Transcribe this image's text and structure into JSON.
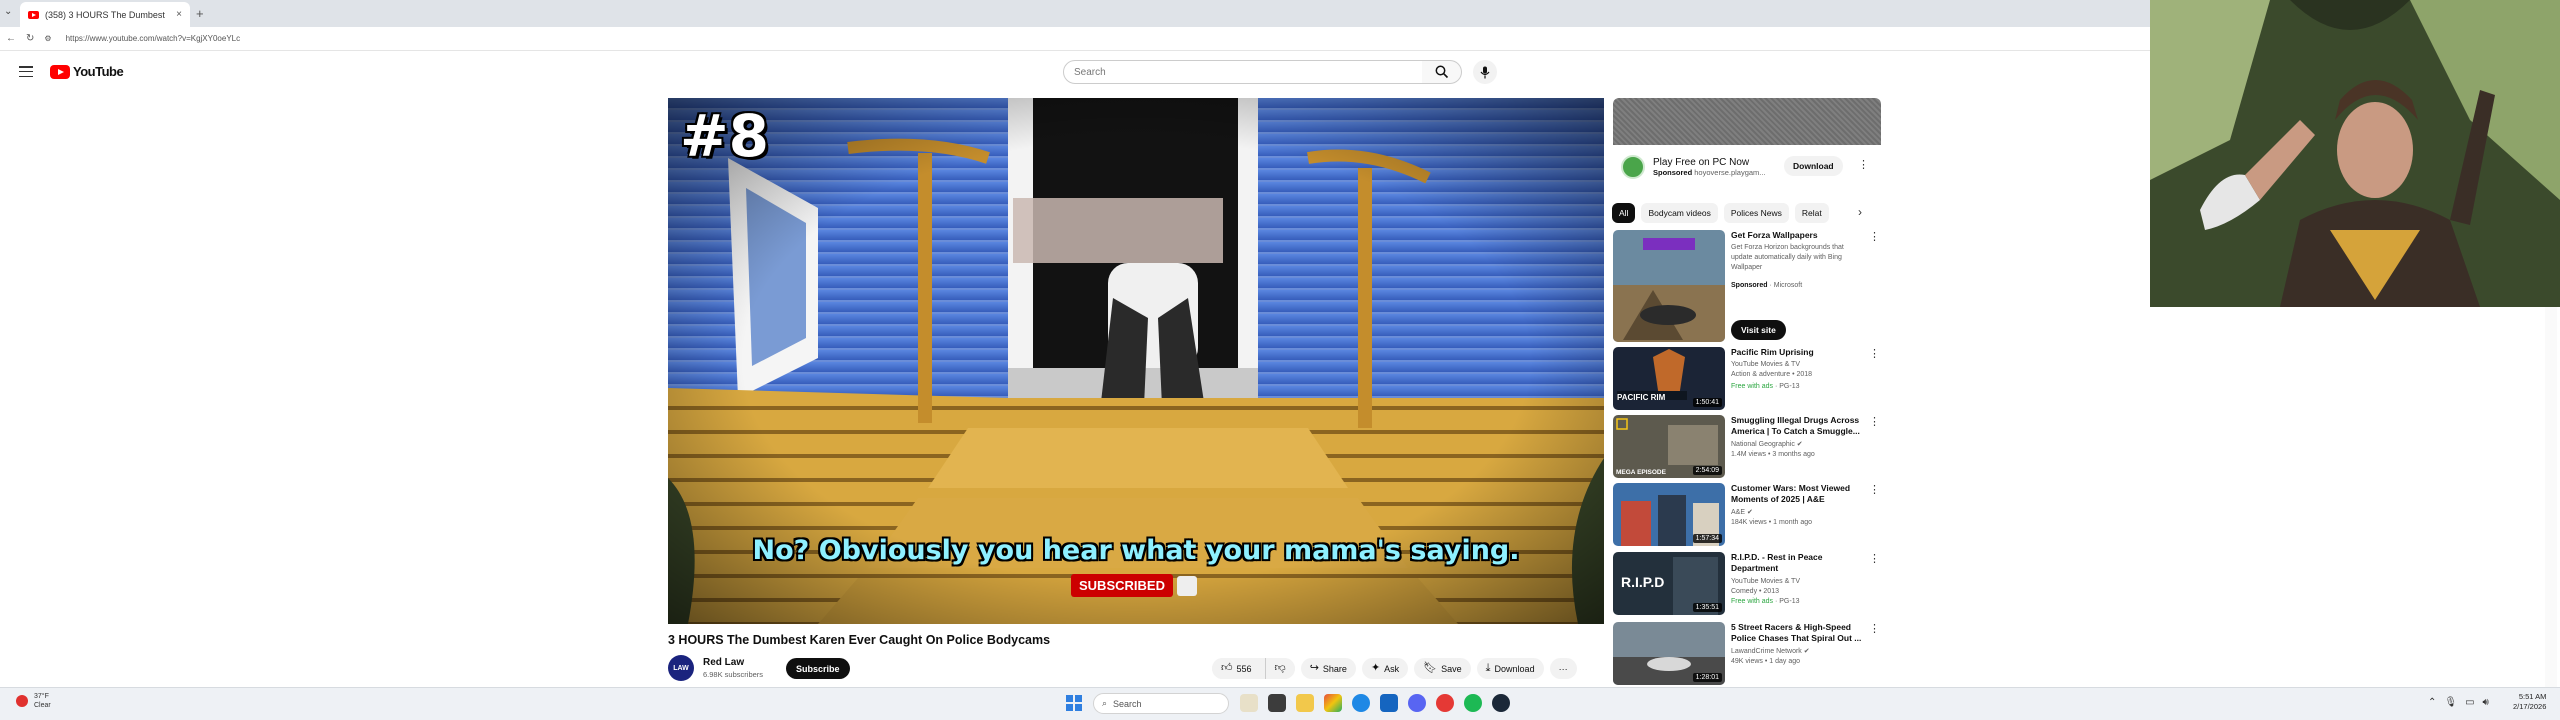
{
  "browser": {
    "tab_title": "(358) 3 HOURS The Dumbest",
    "tab_close": "×",
    "new_tab": "+",
    "url": "https://www.youtube.com/watch?v=KgjXY0oeYLc"
  },
  "yt": {
    "logo_text": "YouTube",
    "search_placeholder": "Search"
  },
  "video": {
    "rank_badge": "#8",
    "caption": "No? Obviously you hear what your mama's saying.",
    "subscribed_overlay": "SUBSCRIBED",
    "title": "3 HOURS The Dumbest Karen Ever Caught On Police Bodycams",
    "channel_name": "Red Law",
    "channel_subs": "6.98K subscribers",
    "channel_avatar_text": "LAW",
    "subscribe_label": "Subscribe",
    "like_count": "556",
    "share_label": "Share",
    "ask_label": "Ask",
    "save_label": "Save",
    "download_label": "Download",
    "more_label": "···"
  },
  "sidebar": {
    "ad": {
      "title": "Play Free on PC Now",
      "sponsored": "Sponsored",
      "advertiser": "hoyoverse.playgam...",
      "download_label": "Download"
    },
    "chips": [
      "All",
      "Bodycam videos",
      "Polices News",
      "Relat"
    ],
    "recommendations": [
      {
        "title": "Get Forza Wallpapers",
        "meta": [
          "Get Forza Horizon backgrounds that",
          "update automatically daily with Bing",
          "Wallpaper"
        ],
        "badge_prefix": "Sponsored",
        "badge_suffix": "· Microsoft",
        "visit_label": "Visit site",
        "thumb_text": ""
      },
      {
        "title": "Pacific Rim Uprising",
        "meta": [
          "YouTube Movies & TV",
          "Action & adventure • 2018"
        ],
        "free": "Free with ads",
        "rating": "· PG-13",
        "duration": "1:50:41",
        "thumb_text": "PACIFIC RIM"
      },
      {
        "title": "Smuggling Illegal Drugs Across America | To Catch a Smuggle...",
        "meta": [
          "National Geographic ✔",
          "1.4M views • 3 months ago"
        ],
        "duration": "2:54:09",
        "thumb_text": "MEGA EPISODE"
      },
      {
        "title": "Customer Wars: Most Viewed Moments of 2025 | A&E",
        "meta": [
          "A&E ✔",
          "184K views • 1 month ago"
        ],
        "duration": "1:57:34",
        "thumb_text": ""
      },
      {
        "title": "R.I.P.D. - Rest in Peace Department",
        "meta": [
          "YouTube Movies & TV",
          "Comedy • 2013"
        ],
        "free": "Free with ads",
        "rating": "· PG-13",
        "duration": "1:35:51",
        "thumb_text": "R.I.P.D"
      },
      {
        "title": "5 Street Racers & High-Speed Police Chases That Spiral Out ...",
        "meta": [
          "LawandCrime Network ✔",
          "49K views • 1 day ago"
        ],
        "duration": "1:28:01",
        "thumb_text": ""
      }
    ]
  },
  "taskbar": {
    "weather_temp": "37°F",
    "weather_desc": "Clear",
    "search_label": "Search",
    "time": "5:51 AM",
    "date": "2/17/2026"
  },
  "colors": {
    "yt_red": "#ff0000",
    "free_green": "#2ba640",
    "player_bg": "#3a5fb0"
  }
}
